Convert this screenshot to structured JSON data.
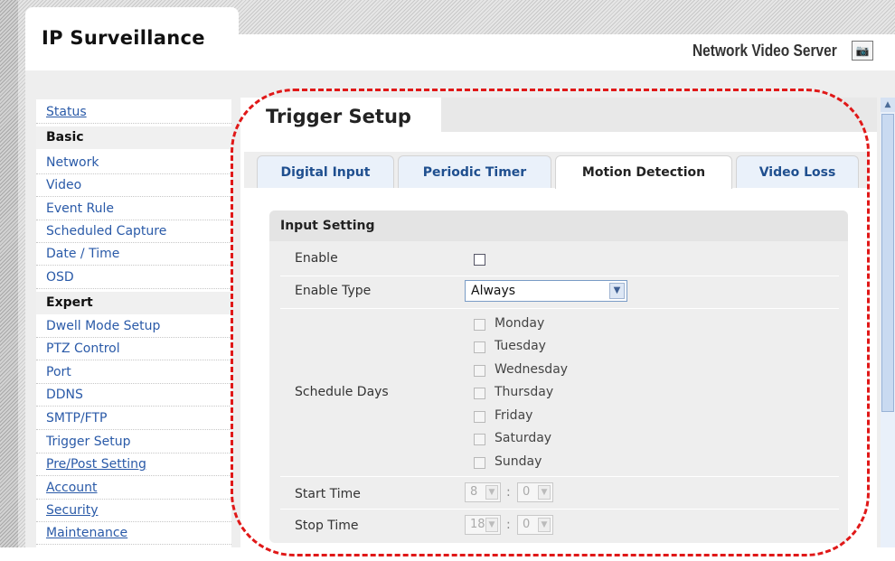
{
  "header": {
    "app_title": "IP Surveillance",
    "product_name": "Network Video Server",
    "snapshot_icon": "camera-icon"
  },
  "sidebar": {
    "items": [
      {
        "label": "Status",
        "type": "link"
      },
      {
        "label": "Basic",
        "type": "heading"
      },
      {
        "label": "Network",
        "type": "link"
      },
      {
        "label": "Video",
        "type": "link"
      },
      {
        "label": "Event Rule",
        "type": "link"
      },
      {
        "label": "Scheduled Capture",
        "type": "link"
      },
      {
        "label": "Date / Time",
        "type": "link"
      },
      {
        "label": "OSD",
        "type": "link"
      },
      {
        "label": "Expert",
        "type": "heading"
      },
      {
        "label": "Dwell Mode Setup",
        "type": "link"
      },
      {
        "label": "PTZ Control",
        "type": "link"
      },
      {
        "label": "Port",
        "type": "link"
      },
      {
        "label": "DDNS",
        "type": "link"
      },
      {
        "label": "SMTP/FTP",
        "type": "link"
      },
      {
        "label": "Trigger Setup",
        "type": "link"
      },
      {
        "label": "Pre/Post Setting",
        "type": "link"
      },
      {
        "label": "Account",
        "type": "link"
      },
      {
        "label": "Security",
        "type": "link"
      },
      {
        "label": "Maintenance",
        "type": "link"
      }
    ]
  },
  "main": {
    "page_title": "Trigger Setup",
    "tabs": [
      {
        "label": "Digital Input",
        "active": false
      },
      {
        "label": "Periodic Timer",
        "active": false
      },
      {
        "label": "Motion Detection",
        "active": true
      },
      {
        "label": "Video Loss",
        "active": false
      }
    ],
    "section_title": "Input Setting",
    "enable_label": "Enable",
    "enable_checked": false,
    "enable_type_label": "Enable Type",
    "enable_type_value": "Always",
    "schedule_days_label": "Schedule Days",
    "days": [
      "Monday",
      "Tuesday",
      "Wednesday",
      "Thursday",
      "Friday",
      "Saturday",
      "Sunday"
    ],
    "start_time_label": "Start Time",
    "start_hour": "8",
    "start_minute": "0",
    "stop_time_label": "Stop Time",
    "stop_hour": "18",
    "stop_minute": "0",
    "time_separator": ":"
  },
  "colors": {
    "link": "#2a5aa8",
    "tab_text": "#1f4f8f",
    "annotation_dash": "#e01818"
  }
}
